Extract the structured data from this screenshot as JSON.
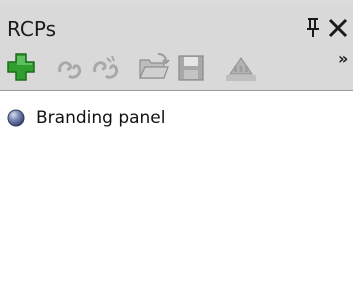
{
  "panel": {
    "title": "RCPs"
  },
  "toolbar": {
    "buttons": [
      {
        "icon": "add-icon",
        "enabled": true
      },
      {
        "icon": "link-icon",
        "enabled": false
      },
      {
        "icon": "unlink-icon",
        "enabled": false
      },
      {
        "icon": "open-folder-icon",
        "enabled": false
      },
      {
        "icon": "save-icon",
        "enabled": false
      },
      {
        "icon": "ship-icon",
        "enabled": false
      }
    ],
    "overflow_label": "»"
  },
  "items": [
    {
      "label": "Branding panel",
      "icon": "sphere-icon"
    }
  ],
  "colors": {
    "titlebar_bg": "#d9d9d9",
    "add_green": "#2fa02f",
    "disabled_gray": "#a8a8a8",
    "sphere_blue": "#4d5d8a"
  }
}
